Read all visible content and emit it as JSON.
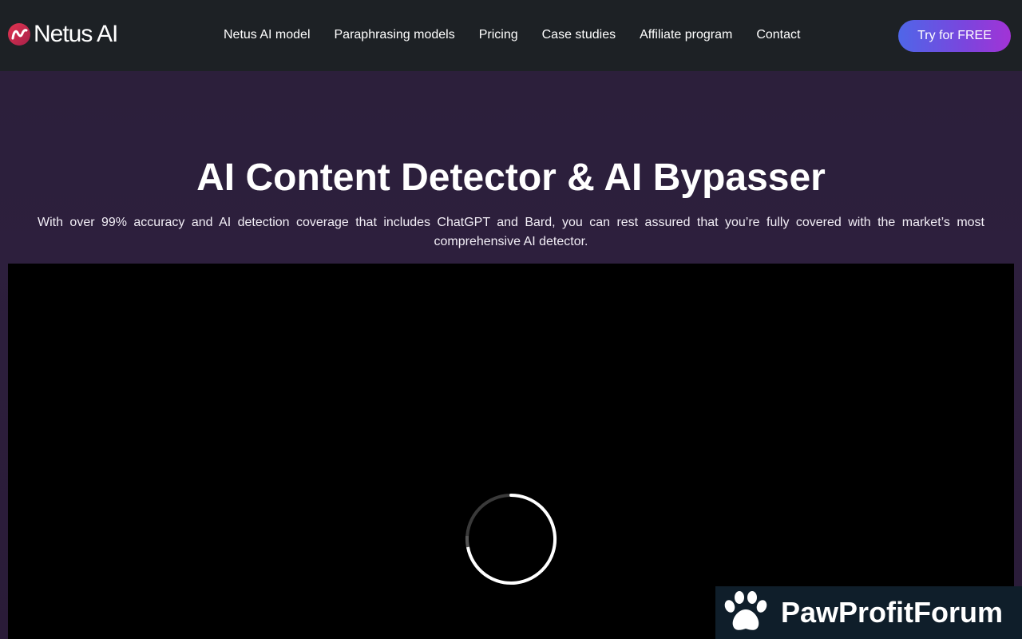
{
  "brand": {
    "name": "Netus AI"
  },
  "nav": {
    "links": [
      {
        "label": "Netus AI model"
      },
      {
        "label": "Paraphrasing models"
      },
      {
        "label": "Pricing"
      },
      {
        "label": "Case studies"
      },
      {
        "label": "Affiliate program"
      },
      {
        "label": "Contact"
      }
    ],
    "cta_label": "Try for FREE"
  },
  "hero": {
    "title": "AI Content Detector & AI Bypasser",
    "subtitle": "With over 99% accuracy and AI detection coverage that includes ChatGPT and Bard, you can rest assured that you’re fully covered with the market’s most comprehensive AI detector."
  },
  "video": {
    "state": "loading",
    "spinner_icon": "loading-spinner-icon"
  },
  "watermark": {
    "text": "PawProfitForum",
    "icon": "paw-icon"
  },
  "colors": {
    "nav_bg": "#1d2125",
    "page_bg": "#2b1f3a",
    "cta_gradient_start": "#4f66e8",
    "cta_gradient_end": "#a233d6",
    "logo_accent": "#d8284a",
    "banner_bg": "#0f1e2a"
  }
}
